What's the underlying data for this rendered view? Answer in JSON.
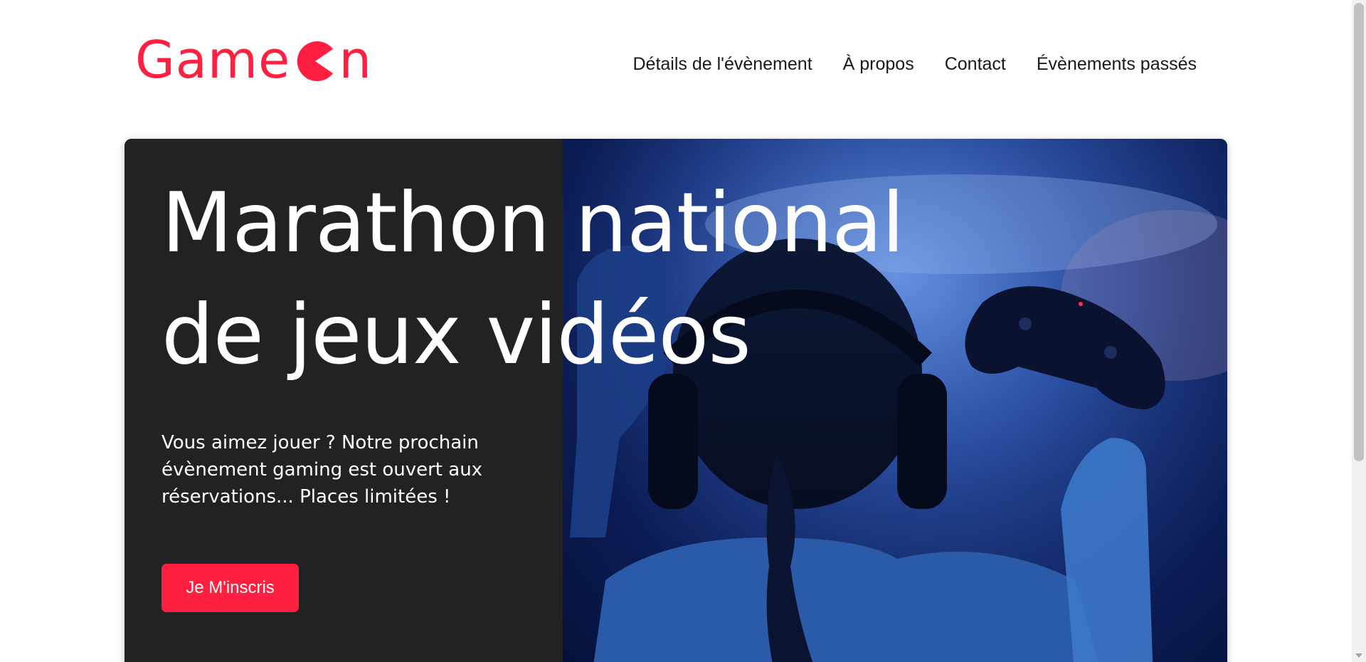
{
  "header": {
    "logo": {
      "prefix": "Game",
      "icon": "pacman-icon",
      "suffix": "n",
      "color": "#ff1f40"
    },
    "nav": [
      {
        "label": "Détails de l'évènement"
      },
      {
        "label": "À propos"
      },
      {
        "label": "Contact"
      },
      {
        "label": "Évènements passés"
      }
    ]
  },
  "hero": {
    "title": "Marathon national de jeux vidéos",
    "text": "Vous aimez jouer ? Notre prochain évènement gaming est ouvert aux réservations... Places limitées !",
    "cta_label": "Je M'inscris",
    "cta_color": "#ff1f40",
    "panel_color": "#222222",
    "image": "gamer-with-headphones-and-controller-photo"
  }
}
